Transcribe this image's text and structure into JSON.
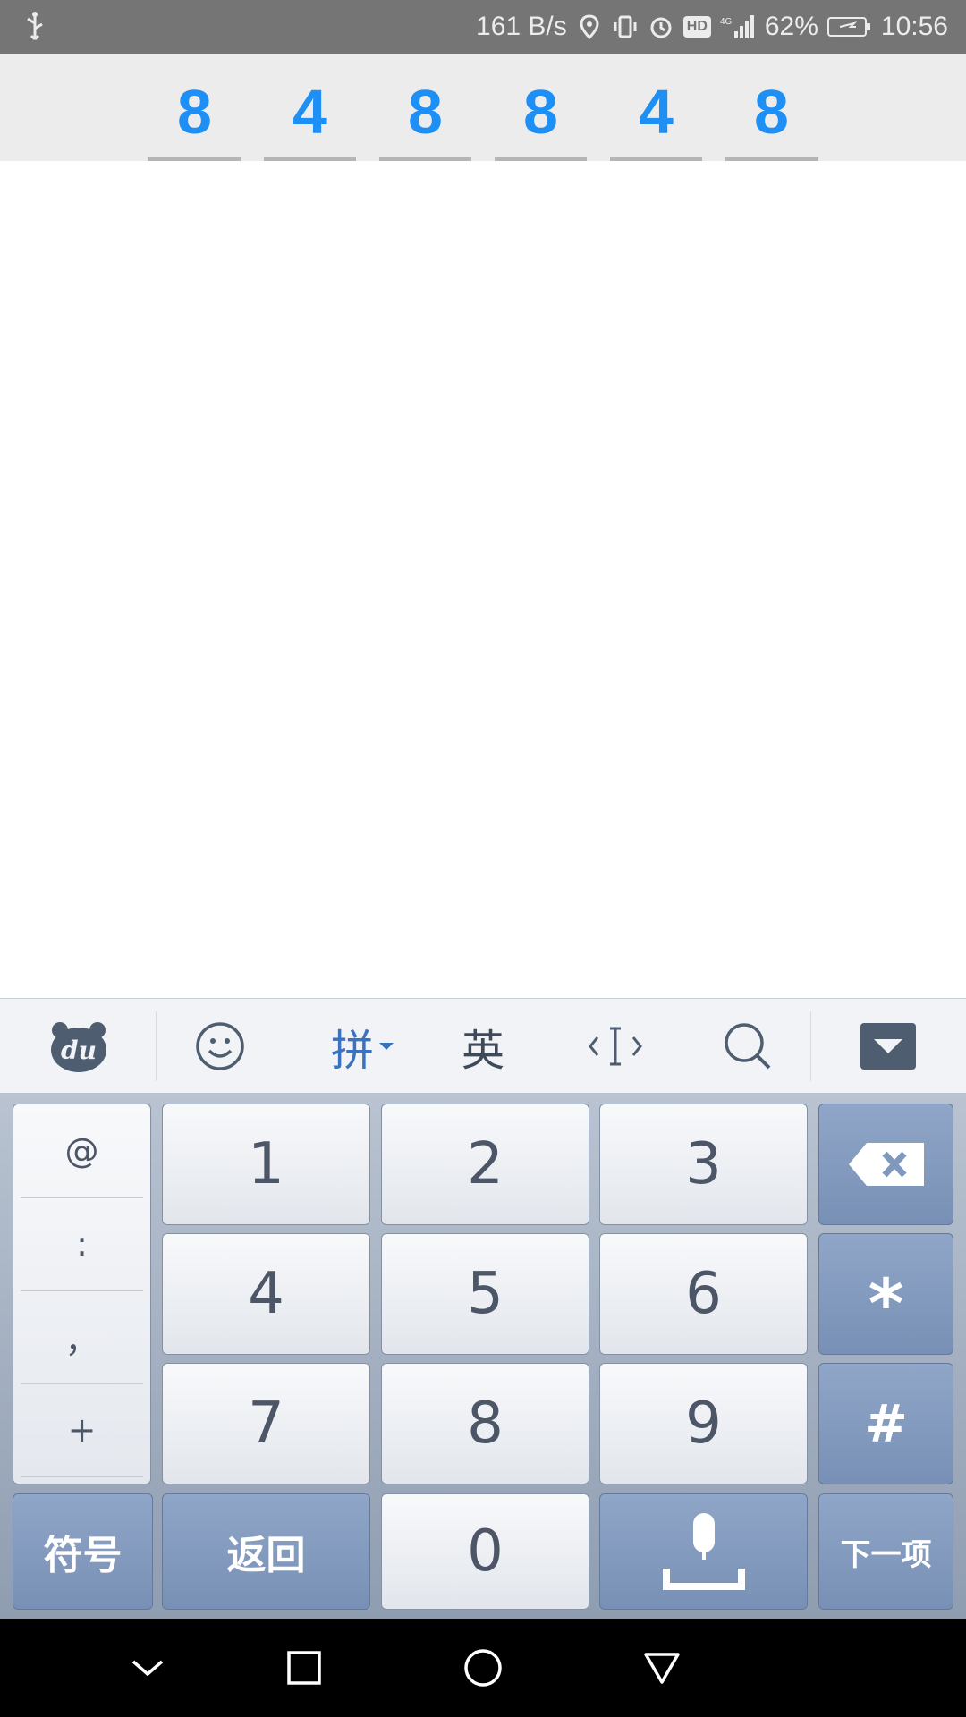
{
  "status_bar": {
    "net_speed": "161 B/s",
    "hd_badge": "HD",
    "network_type": "4G",
    "battery_percent": "62%",
    "time": "10:56"
  },
  "code_entry": {
    "digits": [
      "8",
      "4",
      "8",
      "8",
      "4",
      "8"
    ]
  },
  "keyboard": {
    "toolbar": {
      "pinyin_label": "拼",
      "english_label": "英"
    },
    "symbols": [
      "@",
      ":",
      "，",
      "+"
    ],
    "number_keys": [
      "1",
      "2",
      "3",
      "4",
      "5",
      "6",
      "7",
      "8",
      "9"
    ],
    "star_label": "*",
    "hash_label": "#",
    "zero_label": "0",
    "symbols_key_label": "符号",
    "back_key_label": "返回",
    "next_key_label": "下一项"
  },
  "colors": {
    "digit_blue": "#1e8ff5",
    "key_blue": "#7f98bd",
    "status_bar": "#757575"
  }
}
